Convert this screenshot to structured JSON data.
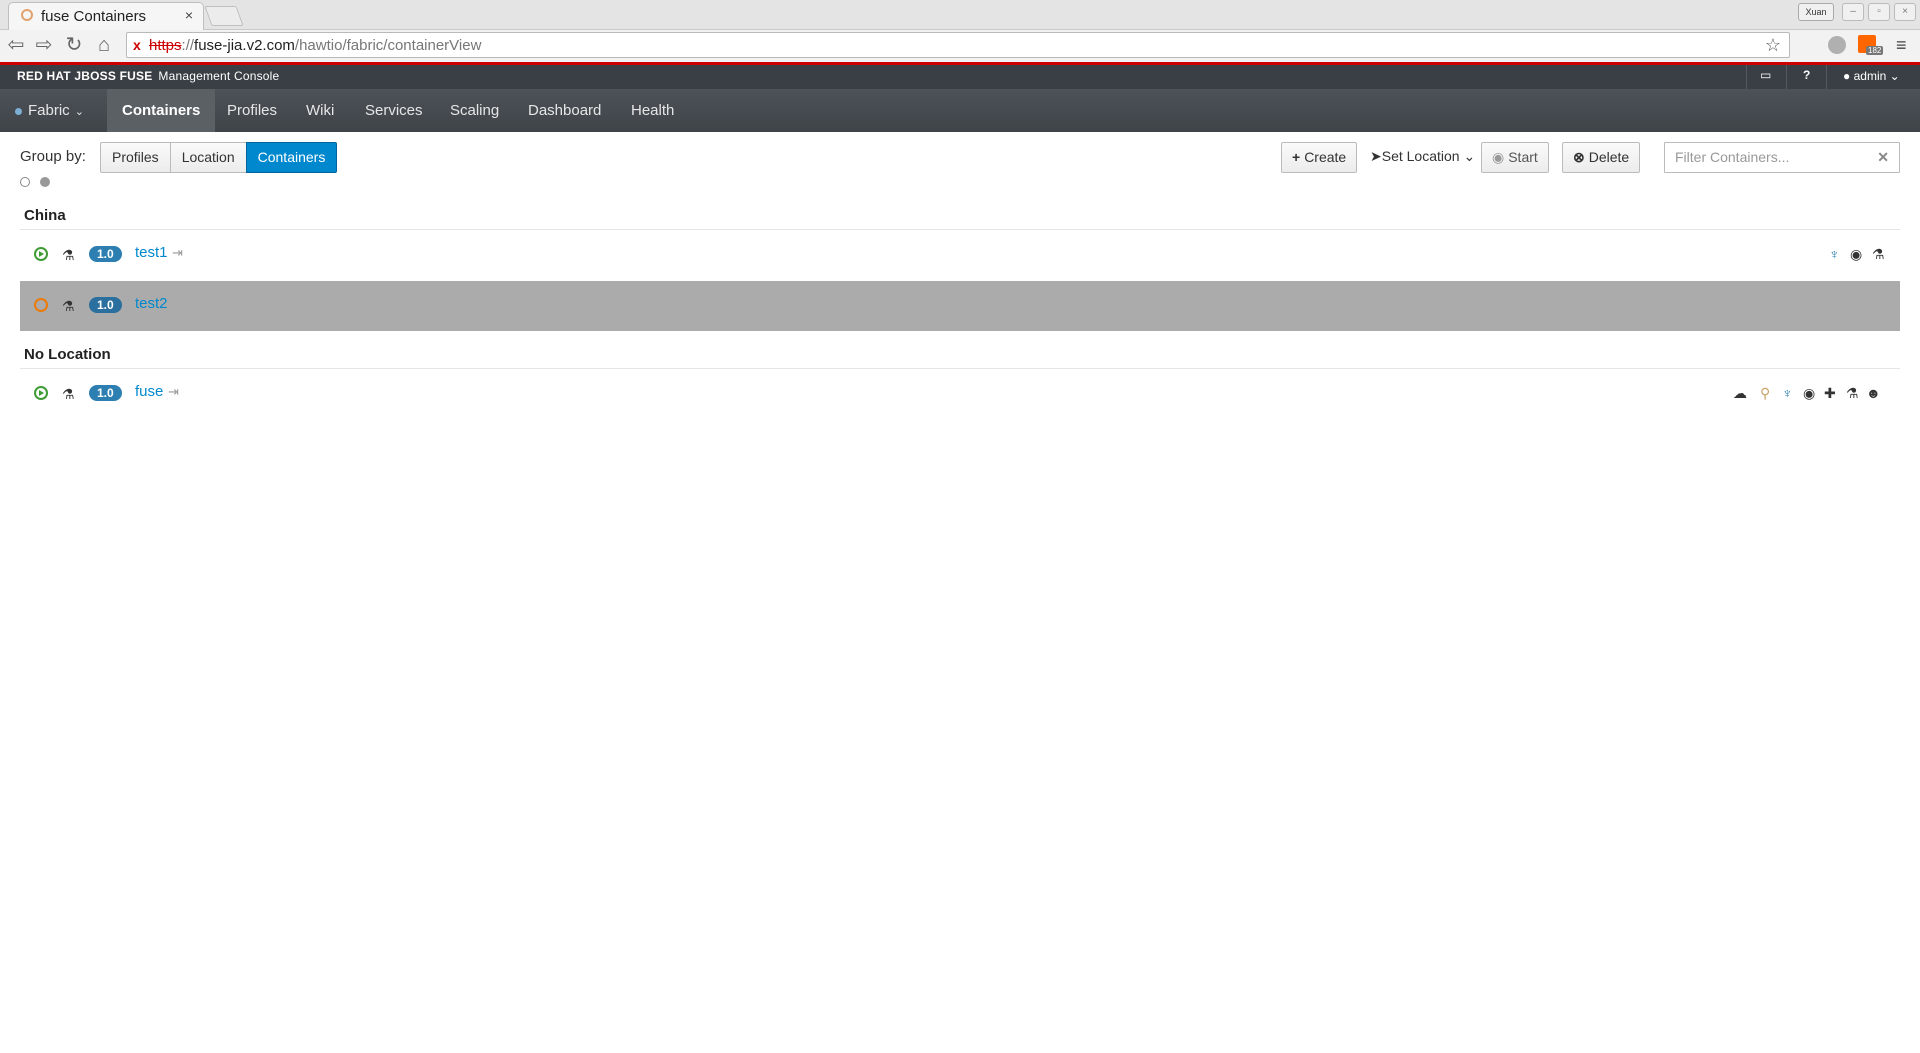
{
  "browser": {
    "tab_title": "fuse Containers",
    "tab_close": "×",
    "user_badge": "Xuan",
    "url_protocol": "https",
    "url_sep": "://",
    "url_host": "fuse-jia.v2.com",
    "url_path": "/hawtio/fabric/containerView",
    "ext_badge": "182"
  },
  "header": {
    "brand": "RED HAT JBOSS FUSE",
    "brand_sub": "Management Console",
    "user": "admin"
  },
  "nav": {
    "fabric": "Fabric",
    "items": [
      "Containers",
      "Profiles",
      "Wiki",
      "Services",
      "Scaling",
      "Dashboard",
      "Health"
    ]
  },
  "toolbar": {
    "group_by_label": "Group by:",
    "group_options": [
      "Profiles",
      "Location",
      "Containers"
    ],
    "create": "Create",
    "set_location": "Set Location",
    "start": "Start",
    "delete": "Delete",
    "filter_placeholder": "Filter Containers..."
  },
  "groups": [
    {
      "title": "China",
      "containers": [
        {
          "version": "1.0",
          "name": "test1"
        },
        {
          "version": "1.0",
          "name": "test2"
        }
      ]
    },
    {
      "title": "No Location",
      "containers": [
        {
          "version": "1.0",
          "name": "fuse"
        }
      ]
    }
  ],
  "colors": {
    "brand_red": "#cc0000",
    "primary": "#0088ce",
    "status_ok": "#3f9c35",
    "status_starting": "#ec7a08"
  }
}
